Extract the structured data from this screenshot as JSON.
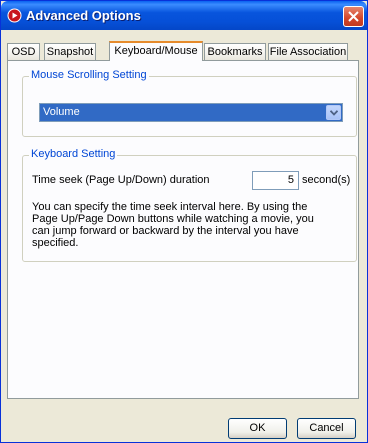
{
  "window": {
    "title": "Advanced Options"
  },
  "tabs": [
    {
      "label": "OSD"
    },
    {
      "label": "Snapshot"
    },
    {
      "label": "Keyboard/Mouse"
    },
    {
      "label": "Bookmarks"
    },
    {
      "label": "File Association"
    }
  ],
  "mouse": {
    "group_title": "Mouse Scrolling Setting",
    "selected_value": "Volume"
  },
  "keyboard": {
    "group_title": "Keyboard Setting",
    "time_seek_label": "Time seek (Page Up/Down) duration",
    "time_seek_value": "5",
    "unit_label": "second(s)",
    "description": "You can specify the time seek interval here. By using the Page Up/Page Down buttons while watching a movie, you can jump forward or backward by the interval you have specified."
  },
  "buttons": {
    "ok": "OK",
    "cancel": "Cancel"
  }
}
